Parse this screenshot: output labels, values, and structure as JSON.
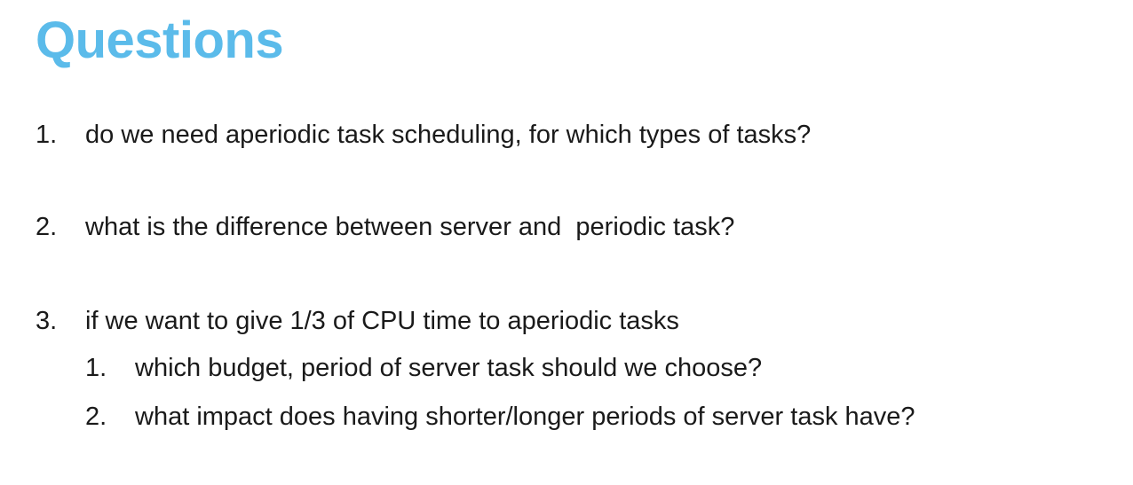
{
  "title": "Questions",
  "colors": {
    "title": "#5bbbea",
    "text": "#1a1a1a",
    "background": "#ffffff"
  },
  "questions": [
    {
      "number": "1.",
      "text": "do we need aperiodic task scheduling, for which types of tasks?"
    },
    {
      "number": "2.",
      "text": "what is the difference between server and  periodic task?"
    },
    {
      "number": "3.",
      "text": "if we want to give 1/3 of CPU time to aperiodic tasks",
      "subitems": [
        {
          "number": "1.",
          "text": "which budget, period of server task should we choose?"
        },
        {
          "number": "2.",
          "text": "what impact does having shorter/longer periods of server task have?"
        }
      ]
    }
  ]
}
